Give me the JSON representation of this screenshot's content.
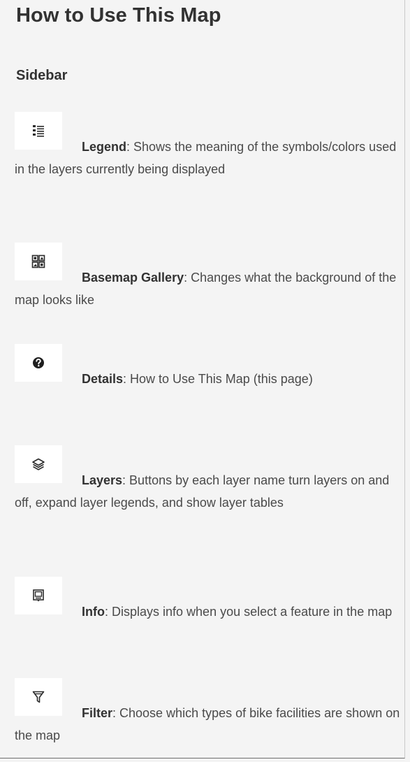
{
  "header": {
    "title": "How to Use This Map",
    "subtitle": "Sidebar"
  },
  "items": [
    {
      "icon": "legend-icon",
      "name": "Legend",
      "description": ": Shows the meaning of the symbols/colors used in the layers currently being displayed"
    },
    {
      "icon": "basemap-gallery-icon",
      "name": "Basemap Gallery",
      "description": ": Changes what the background of the map looks like"
    },
    {
      "icon": "question-circle-icon",
      "name": "Details",
      "description": ": How to Use This Map (this page)"
    },
    {
      "icon": "layers-icon",
      "name": "Layers",
      "description": ": Buttons by each layer name turn layers on and off, expand layer legends, and show layer tables"
    },
    {
      "icon": "info-popup-icon",
      "name": "Info",
      "description": ": Displays info when you select a feature in the map"
    },
    {
      "icon": "filter-icon",
      "name": "Filter",
      "description": ": Choose which types of bike facilities are shown on the map"
    }
  ]
}
